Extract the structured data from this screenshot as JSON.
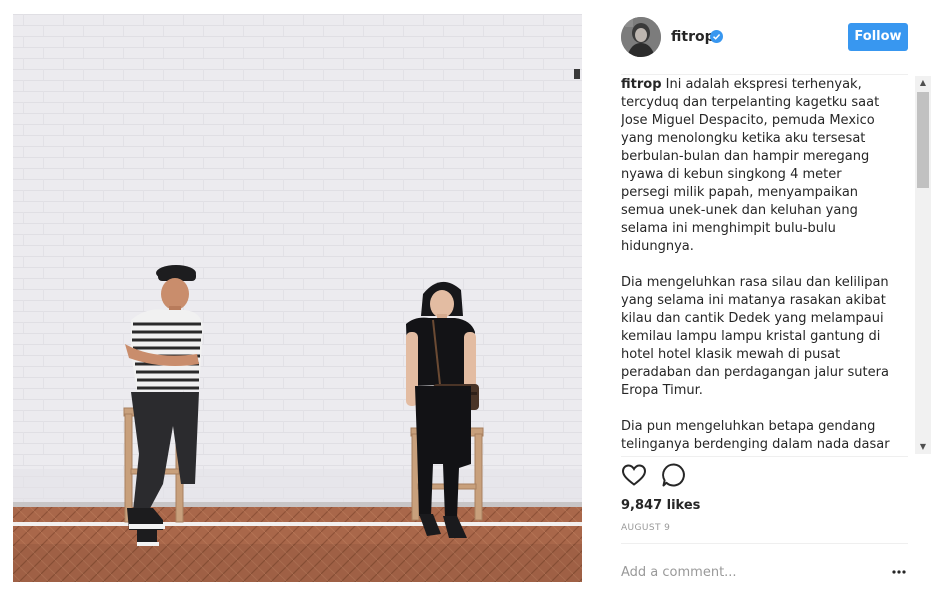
{
  "post": {
    "photo_icon": "photo",
    "colors": {
      "wall": "#ecebef",
      "floor": "#a9674a",
      "accent": "#3897f0",
      "muted": "#999999"
    }
  },
  "header": {
    "username": "fitrop",
    "verified_icon": "verified-badge-icon",
    "follow_label": "Follow"
  },
  "caption": {
    "username": "fitrop",
    "text": " Ini adalah ekspresi terhenyak, tercyduq dan terpelanting kagetku saat Jose Miguel Despacito, pemuda Mexico yang menolongku ketika aku tersesat berbulan-bulan dan hampir meregang nyawa di kebun singkong 4 meter persegi milik papah, menyampaikan semua unek-unek dan keluhan yang selama ini menghimpit bulu-bulu hidungnya.\n\nDia mengeluhkan rasa silau dan kelilipan yang selama ini matanya rasakan akibat kilau dan cantik Dedek yang melampaui kemilau lampu lampu kristal gantung di hotel hotel klasik mewah di pusat peradaban dan perdagangan jalur sutera Eropa Timur.\n\nDia pun mengeluhkan betapa gendang telinganya berdenging dalam nada dasar do dan pukiayu"
  },
  "actions": {
    "like_icon": "heart-icon",
    "comment_icon": "speech-bubble-icon"
  },
  "likes": "9,847 likes",
  "date": "AUGUST 9",
  "comment": {
    "placeholder": "Add a comment...",
    "more_icon": "ellipsis-icon"
  }
}
